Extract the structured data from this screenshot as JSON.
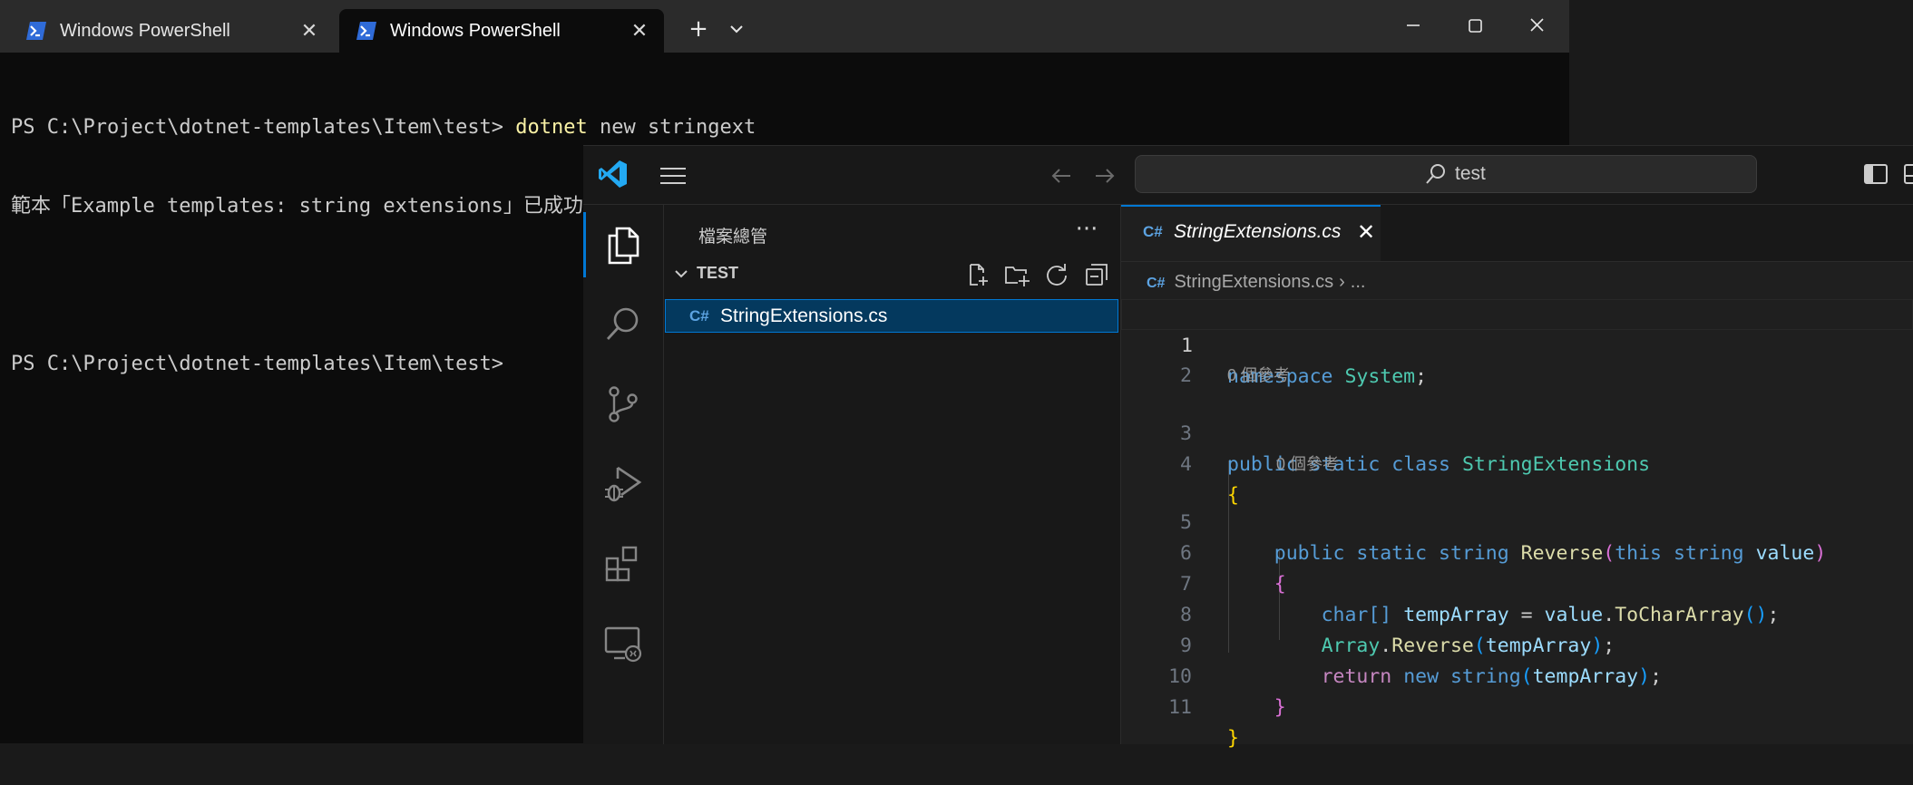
{
  "terminal": {
    "tabs": [
      {
        "label": "Windows PowerShell",
        "active": false
      },
      {
        "label": "Windows PowerShell",
        "active": true
      }
    ],
    "new_tab_label": "+",
    "lines": [
      {
        "prompt": "PS C:\\Project\\dotnet-templates\\Item\\test> ",
        "cmd": "dotnet",
        "args": " new stringext"
      },
      {
        "text": "範本「Example templates: string extensions」已成功建立。"
      },
      {
        "text": ""
      },
      {
        "prompt": "PS C:\\Project\\dotnet-templates\\Item\\test> ",
        "cmd": "",
        "args": ""
      }
    ]
  },
  "vscode": {
    "search_text": "test",
    "explorer": {
      "title": "檔案總管",
      "more": "···",
      "folder": "TEST",
      "files": [
        {
          "icon": "C#",
          "name": "StringExtensions.cs"
        }
      ]
    },
    "editor": {
      "tab": {
        "icon": "C#",
        "title": "StringExtensions.cs"
      },
      "breadcrumb": {
        "icon": "C#",
        "file": "StringExtensions.cs",
        "more": "..."
      },
      "codelens": [
        "0 個參考",
        "0 個參考"
      ],
      "line_numbers": [
        "1",
        "2",
        "3",
        "4",
        "5",
        "6",
        "7",
        "8",
        "9",
        "10",
        "11"
      ],
      "code": {
        "l1": {
          "kw": "namespace",
          "ns": "System",
          "semi": ";"
        },
        "l3": {
          "kw1": "public",
          "kw2": "static",
          "kw3": "class",
          "name": "StringExtensions"
        },
        "l4": {
          "brace": "{"
        },
        "l5": {
          "kw1": "public",
          "kw2": "static",
          "kw3": "string",
          "name": "Reverse",
          "open": "(",
          "kw4": "this",
          "kw5": "string",
          "param": "value",
          "close": ")"
        },
        "l6": {
          "brace": "{"
        },
        "l7": {
          "type": "char[]",
          "var": "tempArray",
          "eq": " = ",
          "obj": "value",
          "dot": ".",
          "method": "ToCharArray",
          "parens": "()",
          "semi": ";"
        },
        "l8": {
          "type": "Array",
          "dot": ".",
          "method": "Reverse",
          "open": "(",
          "arg": "tempArray",
          "close": ")",
          "semi": ";"
        },
        "l9": {
          "kw": "return",
          "kw2": "new",
          "type": "string",
          "open": "(",
          "arg": "tempArray",
          "close": ")",
          "semi": ";"
        },
        "l10": {
          "brace": "}"
        },
        "l11": {
          "brace": "}"
        }
      }
    }
  },
  "colors": {
    "accent": "#0078d4",
    "terminal_bg": "#0c0c0c",
    "editor_bg": "#1f1f1f",
    "selection_bg": "#04395e"
  }
}
